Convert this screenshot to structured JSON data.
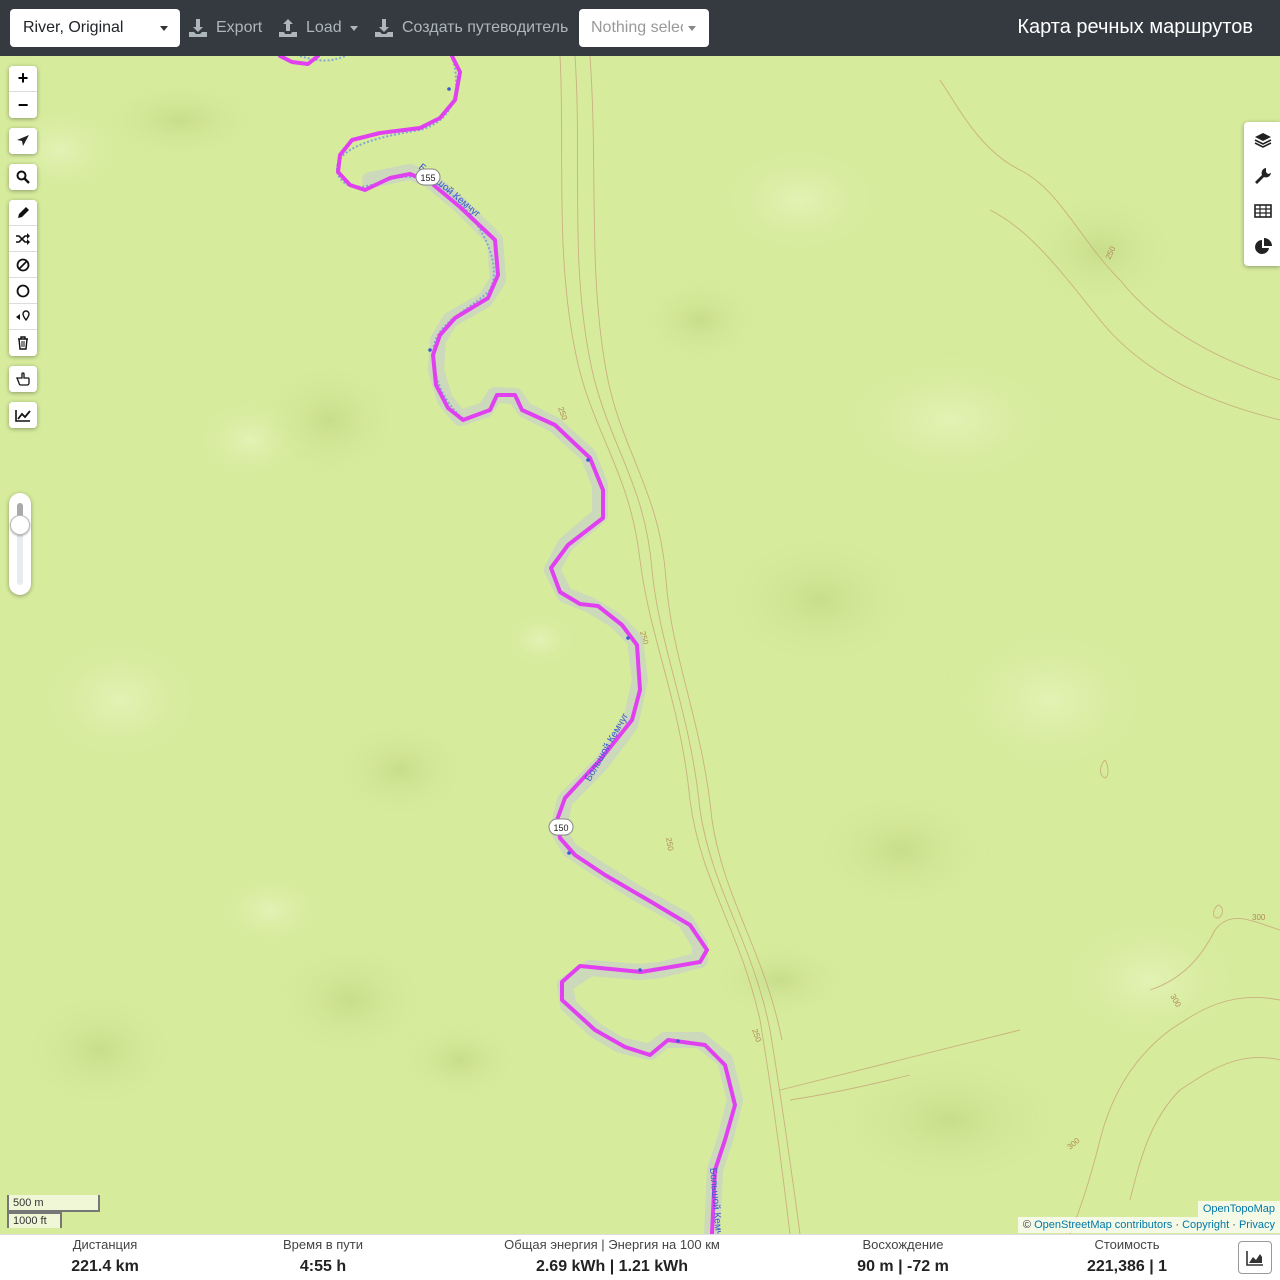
{
  "navbar": {
    "profile_select": "River, Original",
    "export_label": "Export",
    "load_label": "Load",
    "create_guide_label": "Создать путеводитель",
    "nothing_selected": "Nothing selected",
    "brand": "Карта речных маршрутов"
  },
  "map_controls": {
    "zoom_in": "+",
    "zoom_out": "−",
    "zoom_slider_level": 0.27
  },
  "map_labels": {
    "river_name": "Большой Кемчуг",
    "km_marker_1": "155",
    "km_marker_2": "150",
    "contour_250": "250",
    "contour_300": "300"
  },
  "scale": {
    "metric": "500 m",
    "imperial": "1000 ft"
  },
  "attribution": {
    "layer": "OpenTopoMap",
    "copy_prefix": "©",
    "osm": "OpenStreetMap contributors",
    "sep": "·",
    "copyright": "Copyright",
    "privacy": "Privacy"
  },
  "stats": {
    "distance_label": "Дистанция",
    "distance_value": "221.4 km",
    "time_label": "Время в пути",
    "time_value": "4:55 h",
    "energy_label": "Общая энергия | Энергия на 100 км",
    "energy_value": "2.69 kWh | 1.21 kWh",
    "ascent_label": "Восхождение",
    "ascent_value": "90 m | -72 m",
    "cost_label": "Стоимость",
    "cost_value": "221,386 | 1"
  },
  "colors": {
    "navbar": "#343a40",
    "route": "#e040f0",
    "river": "#a9c8e8",
    "terrain": "#d6eb9c"
  }
}
